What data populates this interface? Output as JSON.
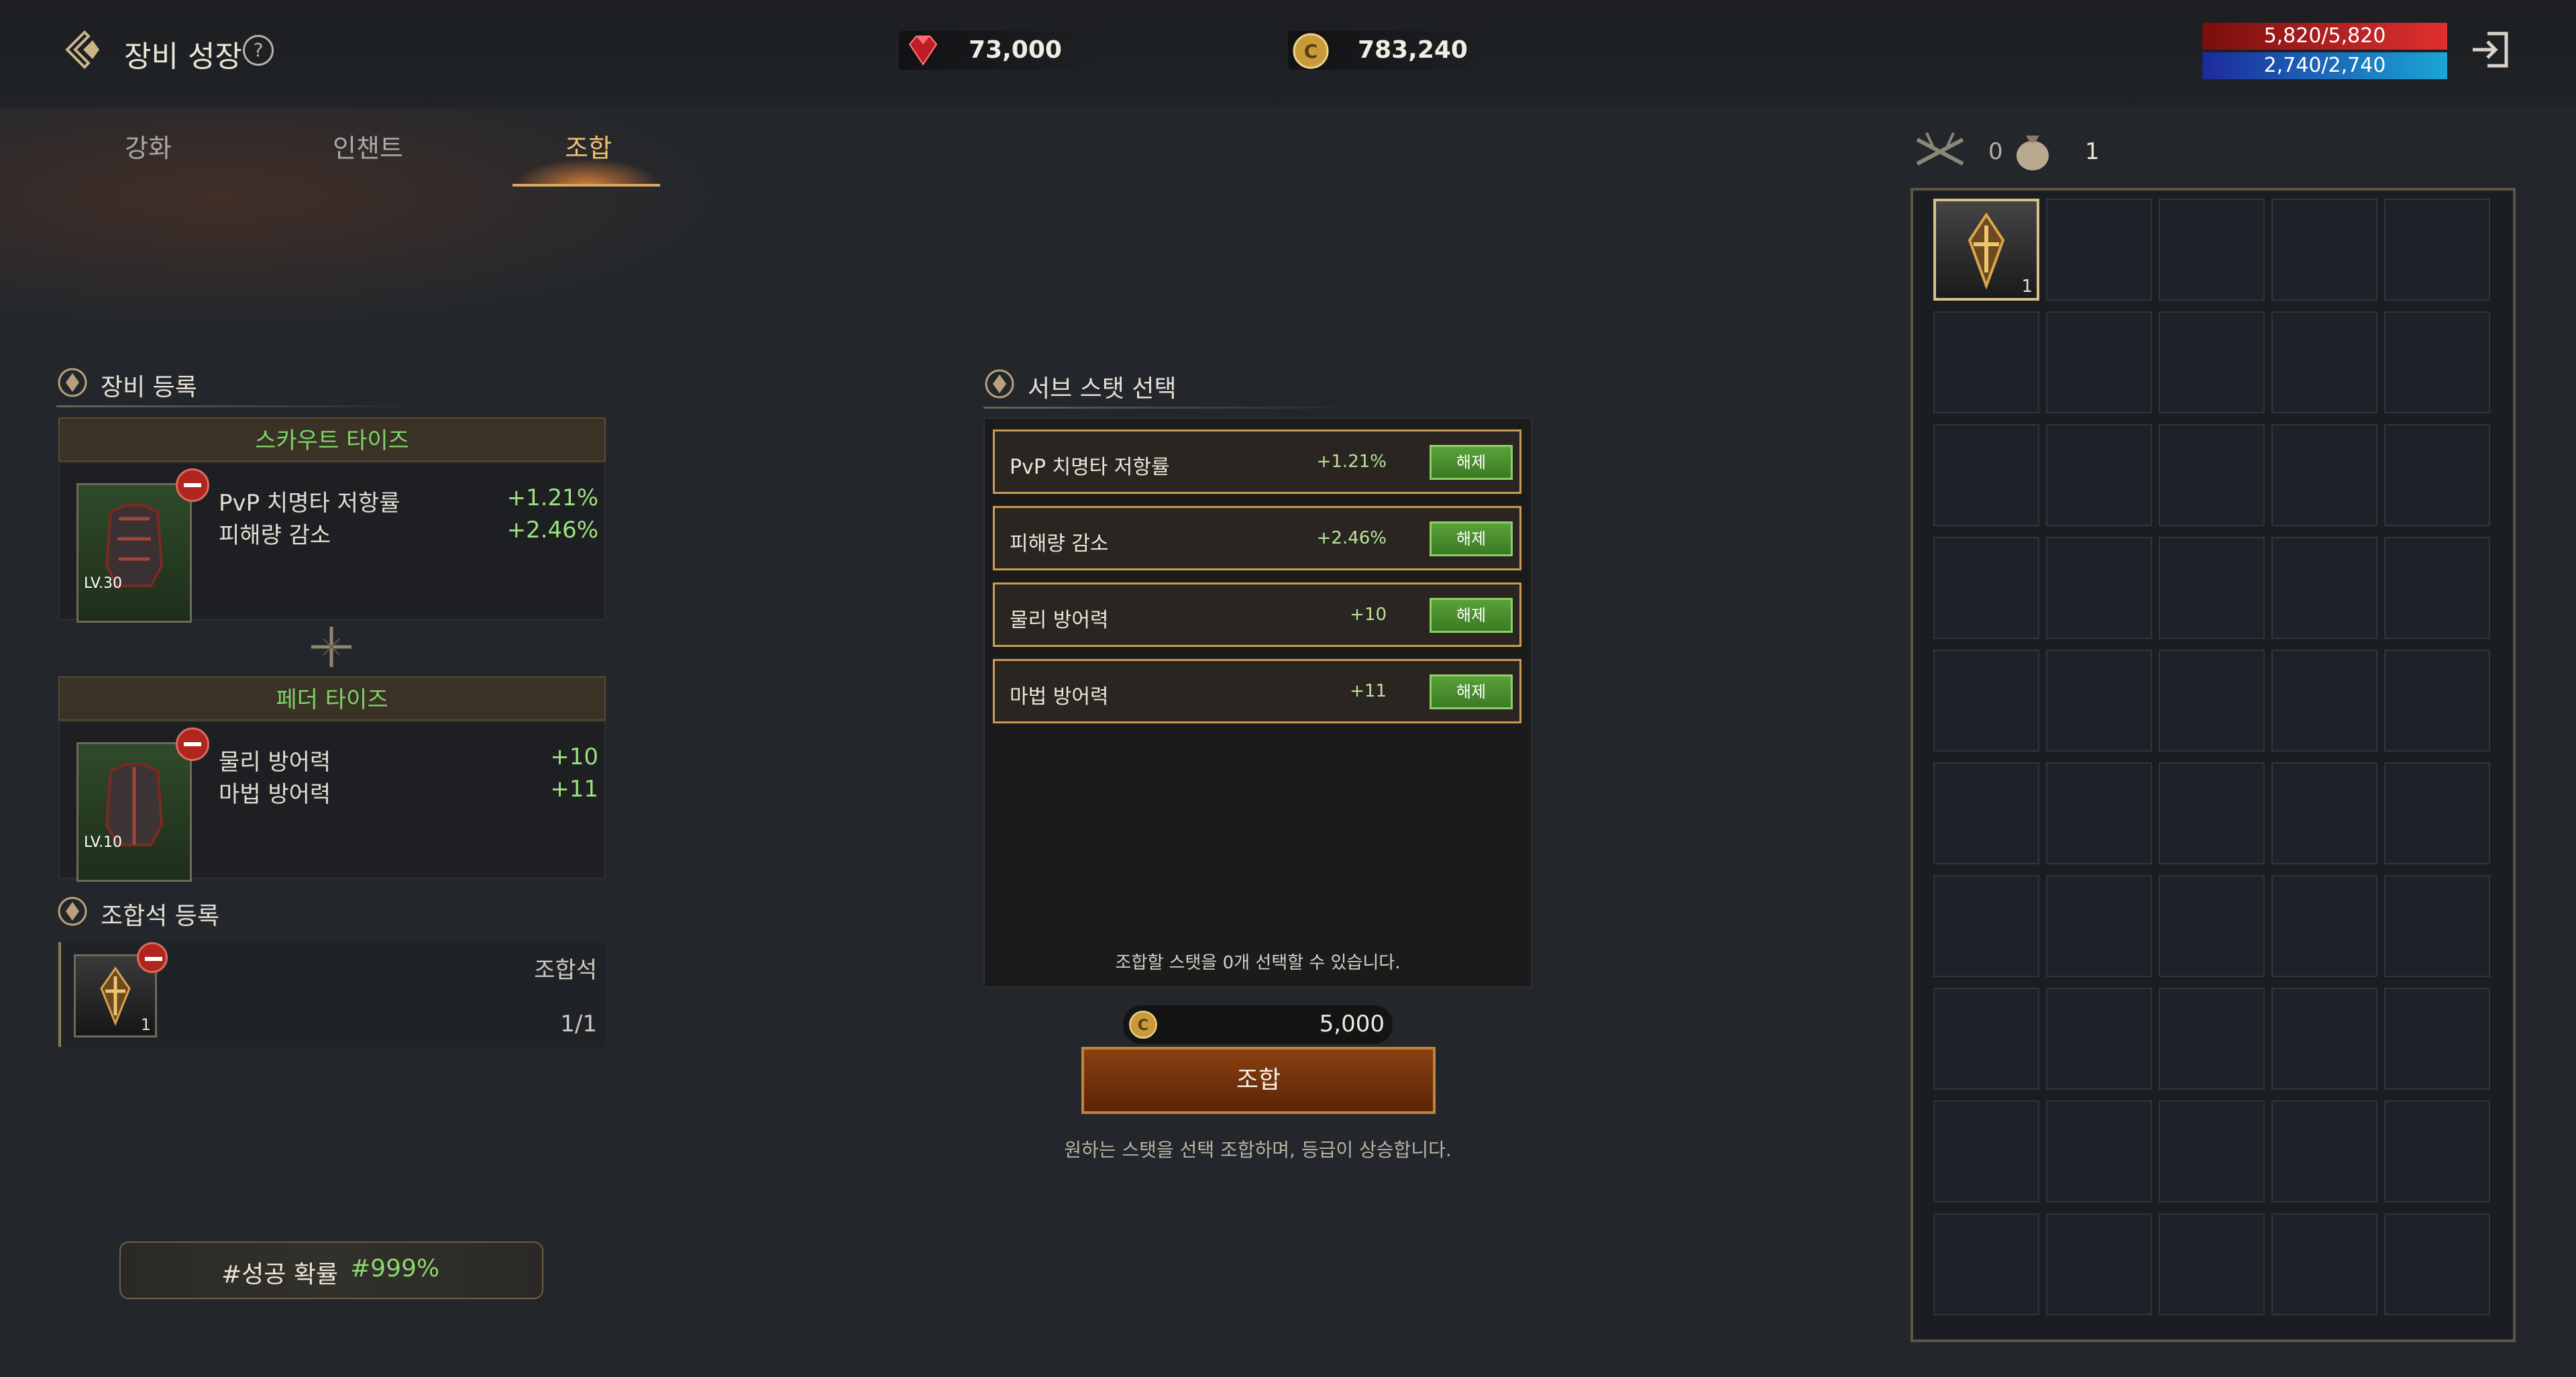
{
  "header": {
    "title": "장비 성장",
    "help_glyph": "?",
    "gems": "73,000",
    "coins": "783,240",
    "hp": "5,820/5,820",
    "mp": "2,740/2,740"
  },
  "tabs": [
    {
      "label": "강화",
      "active": false
    },
    {
      "label": "인챈트",
      "active": false
    },
    {
      "label": "조합",
      "active": true
    }
  ],
  "equipment": {
    "section_title": "장비 등록",
    "items": [
      {
        "name": "스카우트 타이즈",
        "level": "LV.30",
        "stats": [
          {
            "name": "PvP 치명타 저항률",
            "value": "+1.21%"
          },
          {
            "name": "피해량 감소",
            "value": "+2.46%"
          }
        ]
      },
      {
        "name": "페더 타이즈",
        "level": "LV.10",
        "stats": [
          {
            "name": "물리 방어력",
            "value": "+10"
          },
          {
            "name": "마법 방어력",
            "value": "+11"
          }
        ]
      }
    ]
  },
  "stone": {
    "section_title": "조합석 등록",
    "name": "조합석",
    "count": "1/1",
    "qty": "1"
  },
  "success": {
    "label": "#성공 확률",
    "value": "#999%"
  },
  "substat": {
    "section_title": "서브 스탯 선택",
    "rows": [
      {
        "name": "PvP 치명타 저항률",
        "value": "+1.21%",
        "button": "해제"
      },
      {
        "name": "피해량 감소",
        "value": "+2.46%",
        "button": "해제"
      },
      {
        "name": "물리 방어력",
        "value": "+10",
        "button": "해제"
      },
      {
        "name": "마법 방어력",
        "value": "+11",
        "button": "해제"
      }
    ],
    "hint": "조합할 스탯을 0개 선택할 수 있습니다."
  },
  "combine": {
    "cost": "5,000",
    "button": "조합",
    "desc": "원하는 스탯을 선택 조합하며, 등급이 상승합니다."
  },
  "inventory": {
    "weapon_count": "0",
    "bag_count": "1",
    "first_item_qty": "1"
  },
  "colors": {
    "accent": "#c99a52",
    "green": "#7ed36b",
    "hp": "#c21c1c",
    "mp": "#1aa6d6"
  }
}
